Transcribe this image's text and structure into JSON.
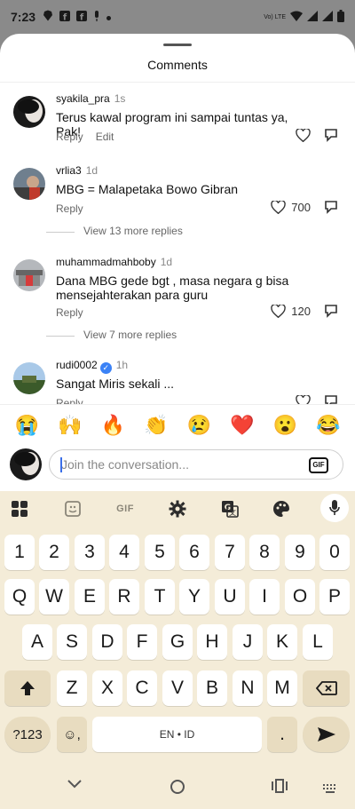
{
  "status_bar": {
    "time": "7:23",
    "lte_label": "Vo) LTE",
    "icons": [
      "brave-icon",
      "facebook-icon",
      "facebook-icon",
      "mic-icon",
      "dot-icon"
    ],
    "right_icons": [
      "wifi-icon",
      "signal-icon",
      "signal-icon",
      "battery-icon"
    ]
  },
  "sheet": {
    "title": "Comments"
  },
  "comments": [
    {
      "username": "syakila_pra",
      "time": "1s",
      "text": "Terus kawal program ini sampai tuntas ya, Pak!",
      "reply_label": "Reply",
      "edit_label": "Edit",
      "like_count": ""
    },
    {
      "username": "vrlia3",
      "time": "1d",
      "text": "MBG = Malapetaka Bowo Gibran",
      "reply_label": "Reply",
      "like_count": "700",
      "more_replies": "View 13 more replies"
    },
    {
      "username": "muhammadmahboby",
      "time": "1d",
      "text": "Dana MBG gede bgt , masa negara g bisa mensejahterakan para guru",
      "reply_label": "Reply",
      "like_count": "120",
      "more_replies": "View 7 more replies"
    },
    {
      "username": "rudi0002",
      "verified": true,
      "time": "1h",
      "text": "Sangat Miris sekali ...",
      "reply_label": "Reply",
      "like_count": ""
    }
  ],
  "emoji_bar": [
    "😭",
    "🙌",
    "🔥",
    "👏",
    "😢",
    "❤️",
    "😮",
    "😂"
  ],
  "input": {
    "placeholder": "Join the conversation...",
    "gif_label": "GIF"
  },
  "keyboard": {
    "toolbar": {
      "gif_label": "GIF"
    },
    "row_numbers": [
      "1",
      "2",
      "3",
      "4",
      "5",
      "6",
      "7",
      "8",
      "9",
      "0"
    ],
    "row_1": [
      "Q",
      "W",
      "E",
      "R",
      "T",
      "Y",
      "U",
      "I",
      "O",
      "P"
    ],
    "row_2": [
      "A",
      "S",
      "D",
      "F",
      "G",
      "H",
      "J",
      "K",
      "L"
    ],
    "row_3": [
      "Z",
      "X",
      "C",
      "V",
      "B",
      "N",
      "M"
    ],
    "symbols_label": "?123",
    "emoji_comma": "☺,",
    "space_label": "EN • ID",
    "period_label": "."
  },
  "colors": {
    "keyboard_bg": "#f4ecd8",
    "modifier_key": "#e8dcc0",
    "verified_blue": "#3b82f6",
    "caret": "#3a6ee8"
  }
}
